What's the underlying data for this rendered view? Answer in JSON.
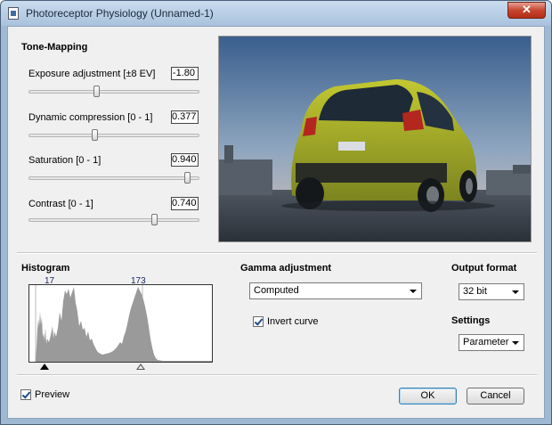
{
  "window": {
    "title": "Photoreceptor Physiology (Unnamed-1)",
    "close_label": "✕"
  },
  "tone_mapping": {
    "heading": "Tone-Mapping",
    "sliders": [
      {
        "label": "Exposure adjustment [±8 EV]",
        "value": "-1.80",
        "fraction": 0.39
      },
      {
        "label": "Dynamic compression [0 - 1]",
        "value": "0.377",
        "fraction": 0.377
      },
      {
        "label": "Saturation [0 - 1]",
        "value": "0.940",
        "fraction": 0.94
      },
      {
        "label": "Contrast [0 - 1]",
        "value": "0.740",
        "fraction": 0.74
      }
    ]
  },
  "histogram": {
    "heading": "Histogram",
    "left_marker": "17",
    "right_marker": "173"
  },
  "gamma": {
    "heading": "Gamma adjustment",
    "selected": "Computed",
    "invert_label": "Invert curve",
    "invert_checked": true
  },
  "output": {
    "heading": "Output format",
    "selected": "32 bit"
  },
  "settings": {
    "heading": "Settings",
    "selected": "Parameter"
  },
  "footer": {
    "preview_label": "Preview",
    "preview_checked": true,
    "ok_label": "OK",
    "cancel_label": "Cancel"
  },
  "colors": {
    "titlebar": "#a9c2dc",
    "close": "#c7452f",
    "car": "#9ea62c",
    "histogram_fill": "#9a9a9a"
  }
}
